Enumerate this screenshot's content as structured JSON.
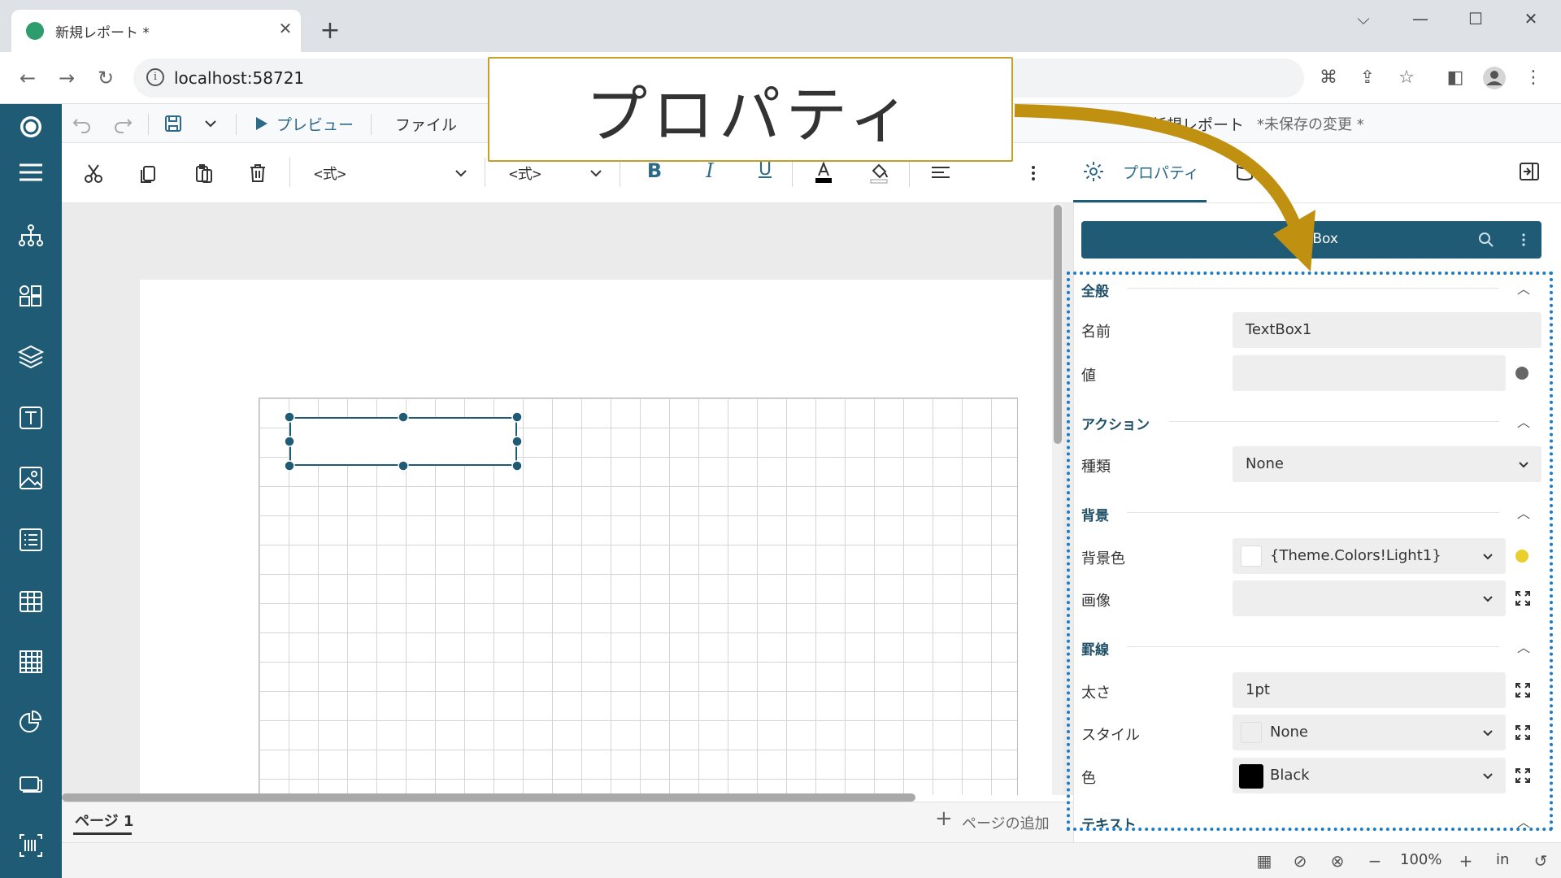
{
  "browser": {
    "tab_title": "新規レポート *",
    "url": "localhost:58721",
    "new_tab": "+",
    "close_tab": "✕"
  },
  "toolbar1": {
    "preview_label": "プレビュー",
    "file_label": "ファイル",
    "report_name": "新規レポート",
    "unsaved": "*未保存の変更 *"
  },
  "toolbar2": {
    "expr1": "<式>",
    "expr2": "<式>",
    "bold": "B",
    "italic": "I",
    "underline": "U"
  },
  "page_tabs": {
    "page1": "ページ 1",
    "add_page": "ページの追加"
  },
  "statusbar": {
    "zoom": "100%",
    "unit": "in"
  },
  "panel": {
    "properties_tab": "プロパティ",
    "header_title": "TextBox",
    "sections": {
      "general": "全般",
      "action": "アクション",
      "background": "背景",
      "border": "罫線",
      "text": "テキスト"
    },
    "fields": {
      "name_label": "名前",
      "name_value": "TextBox1",
      "value_label": "値",
      "value_value": "",
      "kind_label": "種類",
      "kind_value": "None",
      "bgcolor_label": "背景色",
      "bgcolor_value": "{Theme.Colors!Light1}",
      "image_label": "画像",
      "image_value": "",
      "width_label": "太さ",
      "width_value": "1pt",
      "style_label": "スタイル",
      "style_value": "None",
      "color_label": "色",
      "color_value": "Black"
    }
  },
  "callout": {
    "text": "プロパティ"
  },
  "colors": {
    "rail": "#205b76",
    "accent": "#2b6a88",
    "callout_border": "#c3a02a",
    "arrow": "#c09010",
    "dotted_highlight": "#1e7cc4"
  }
}
